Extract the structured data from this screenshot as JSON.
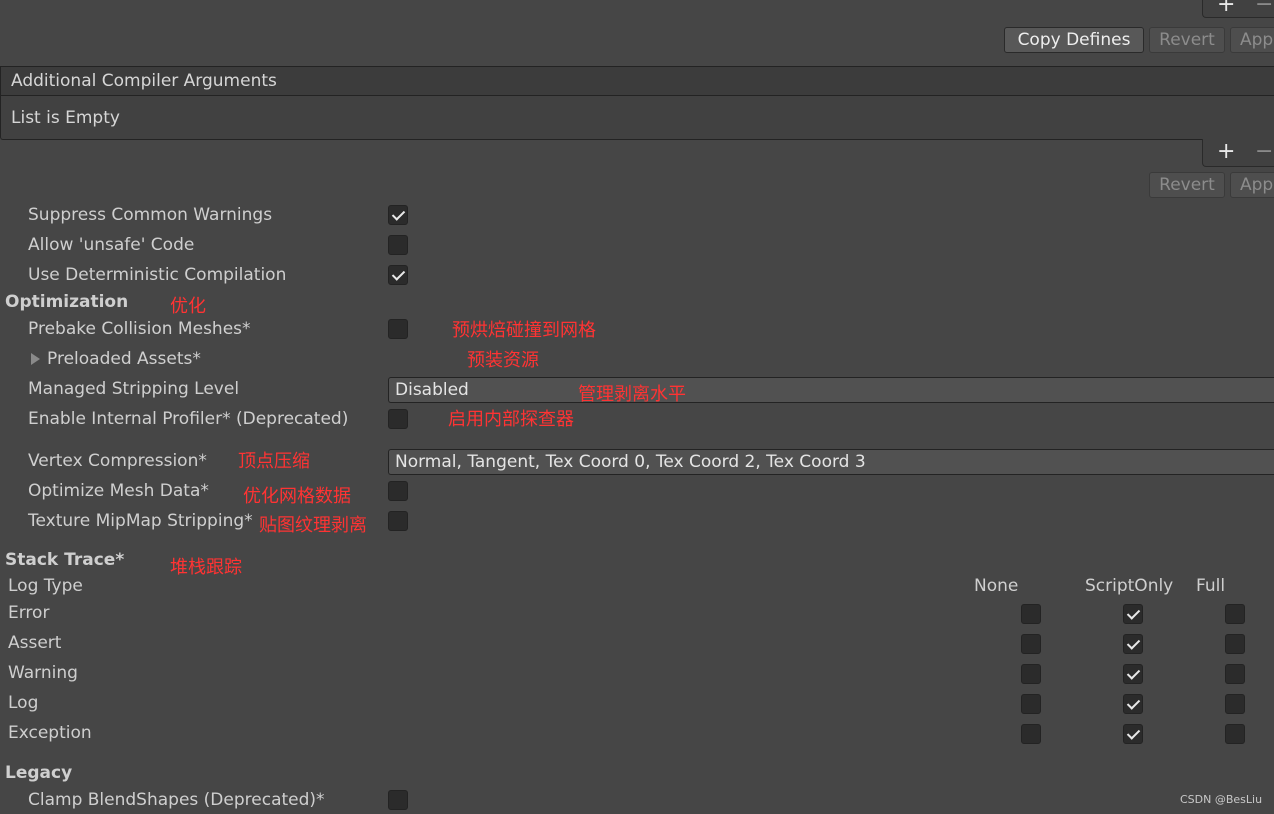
{
  "top_toolbar": {
    "plus": "+",
    "minus": "−",
    "copy_defines": "Copy Defines",
    "revert": "Revert",
    "apply": "Apply"
  },
  "compiler_args": {
    "header": "Additional Compiler Arguments",
    "empty_text": "List is Empty",
    "plus": "+",
    "minus": "−",
    "revert": "Revert",
    "apply": "Apply"
  },
  "settings": {
    "suppress_warnings": {
      "label": "Suppress Common Warnings",
      "checked": true
    },
    "allow_unsafe": {
      "label": "Allow 'unsafe' Code",
      "checked": false
    },
    "deterministic": {
      "label": "Use Deterministic Compilation",
      "checked": true
    }
  },
  "optimization": {
    "title": "Optimization",
    "title_cn": "优化",
    "prebake_label": "Prebake Collision Meshes*",
    "prebake_cn": "预烘焙碰撞到网格",
    "preloaded_label": "Preloaded Assets*",
    "preloaded_cn": "预装资源",
    "stripping_label": "Managed Stripping Level",
    "stripping_value": "Disabled",
    "stripping_cn": "管理剥离水平",
    "profiler_label": "Enable Internal Profiler* (Deprecated)",
    "profiler_cn": "启用内部探查器",
    "vertex_label": "Vertex Compression*",
    "vertex_cn": "顶点压缩",
    "vertex_value": "Normal, Tangent, Tex Coord 0, Tex Coord 2, Tex Coord 3",
    "optimize_mesh_label": "Optimize Mesh Data*",
    "optimize_mesh_cn": "优化网格数据",
    "mipmap_label": "Texture MipMap Stripping*",
    "mipmap_cn": "贴图纹理剥离"
  },
  "stack_trace": {
    "title": "Stack Trace*",
    "title_cn": "堆栈跟踪",
    "col_log_type": "Log Type",
    "col_none": "None",
    "col_script_only": "ScriptOnly",
    "col_full": "Full",
    "rows": [
      {
        "label": "Error",
        "none": false,
        "script_only": true,
        "full": false
      },
      {
        "label": "Assert",
        "none": false,
        "script_only": true,
        "full": false
      },
      {
        "label": "Warning",
        "none": false,
        "script_only": true,
        "full": false
      },
      {
        "label": "Log",
        "none": false,
        "script_only": true,
        "full": false
      },
      {
        "label": "Exception",
        "none": false,
        "script_only": true,
        "full": false
      }
    ]
  },
  "legacy": {
    "title": "Legacy",
    "clamp_label": "Clamp BlendShapes (Deprecated)*",
    "clamp_checked": false
  },
  "watermark": "CSDN @BesLiu"
}
